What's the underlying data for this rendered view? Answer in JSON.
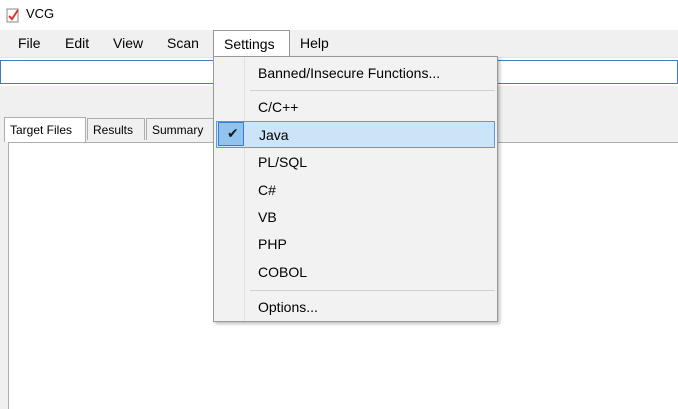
{
  "window": {
    "title": "VCG"
  },
  "menubar": {
    "items": [
      {
        "label": "File"
      },
      {
        "label": "Edit"
      },
      {
        "label": "View"
      },
      {
        "label": "Scan"
      },
      {
        "label": "Settings"
      },
      {
        "label": "Help"
      }
    ]
  },
  "path_input": {
    "value": ""
  },
  "tabs": [
    {
      "label": "Target Files",
      "active": true
    },
    {
      "label": "Results",
      "active": false
    },
    {
      "label": "Summary T",
      "active": false
    }
  ],
  "settings_menu": {
    "items": [
      {
        "label": "Banned/Insecure Functions..."
      },
      {
        "label": "C/C++"
      },
      {
        "label": "Java",
        "checked": true,
        "highlighted": true
      },
      {
        "label": "PL/SQL"
      },
      {
        "label": "C#"
      },
      {
        "label": "VB"
      },
      {
        "label": "PHP"
      },
      {
        "label": "COBOL"
      },
      {
        "label": "Options..."
      }
    ]
  },
  "colors": {
    "accent": "#3d7cc9",
    "highlight": "#cce4f7"
  }
}
